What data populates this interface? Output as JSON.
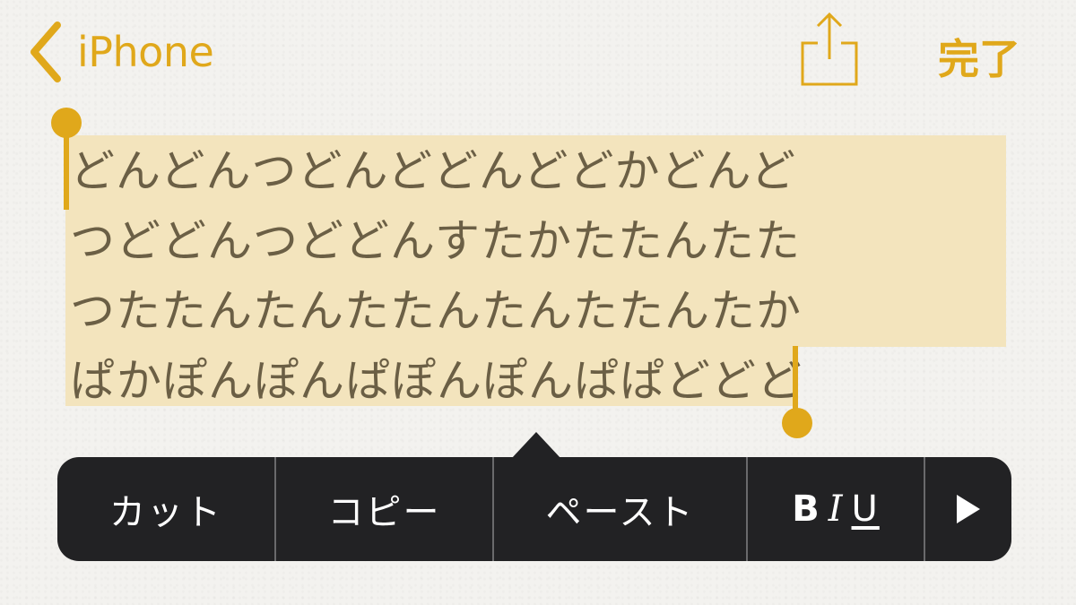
{
  "nav": {
    "back_label": "iPhone",
    "back_icon": "chevron-left-icon",
    "share_icon": "share-icon",
    "done_label": "完了",
    "accent_color": "#e0a81b"
  },
  "note": {
    "lines": [
      "どんどんつどんどどんどどかどんど",
      "つどどんつどどんすたかたたんたた",
      "つたたんたんたたんたんたたんたか",
      "ぱかぽんぽんぱぽんぽんぱぱどどど"
    ],
    "text_color": "#6b5f45",
    "selection_color": "#f3e4bd"
  },
  "edit_menu": {
    "cut": "カット",
    "copy": "コピー",
    "paste": "ペースト",
    "format": {
      "bold": "B",
      "italic": "I",
      "underline": "U"
    },
    "more_icon": "play-arrow-icon",
    "background": "#222224"
  }
}
